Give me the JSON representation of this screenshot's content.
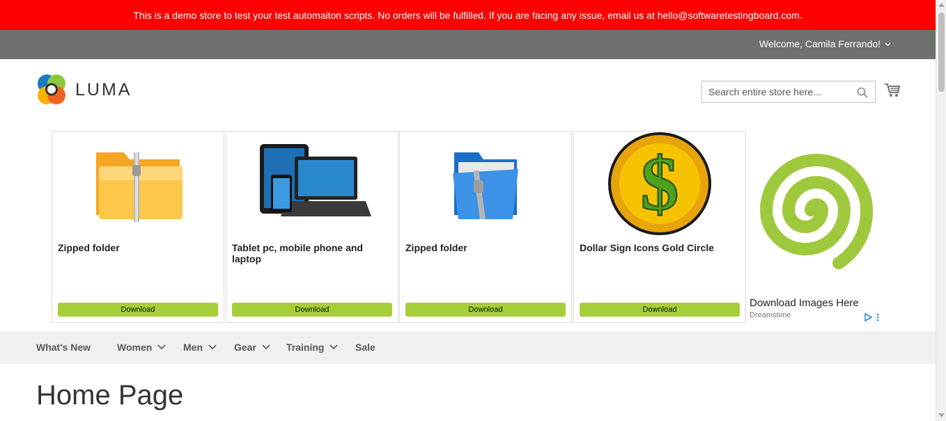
{
  "banner": {
    "text": "This is a demo store to test your test automaiton scripts. No orders will be fulfilled. If you are facing any issue, email us at hello@softwaretestingboard.com."
  },
  "header": {
    "welcome": "Welcome, Camila Ferrando!",
    "logo_text": "LUMA",
    "search_placeholder": "Search entire store here...",
    "icons": {
      "search": "search-icon",
      "cart": "cart-icon",
      "dropdown": "chevron-down-icon"
    }
  },
  "ads": {
    "cards": [
      {
        "title": "Zipped folder",
        "button": "Download",
        "image": "zipped-folder-orange"
      },
      {
        "title": "Tablet pc, mobile phone and laptop",
        "button": "Download",
        "image": "devices"
      },
      {
        "title": "Zipped folder",
        "button": "Download",
        "image": "zipped-folder-blue"
      },
      {
        "title": "Dollar Sign Icons Gold Circle",
        "button": "Download",
        "image": "dollar-coin"
      }
    ],
    "side": {
      "headline": "Download Images Here",
      "brand": "Dreamstime",
      "image": "green-spiral"
    },
    "colors": {
      "button": "#a6ce39"
    }
  },
  "nav": {
    "items": [
      {
        "label": "What's New",
        "has_dropdown": false
      },
      {
        "label": "Women",
        "has_dropdown": true
      },
      {
        "label": "Men",
        "has_dropdown": true
      },
      {
        "label": "Gear",
        "has_dropdown": true
      },
      {
        "label": "Training",
        "has_dropdown": true
      },
      {
        "label": "Sale",
        "has_dropdown": false
      }
    ]
  },
  "page": {
    "title": "Home Page"
  },
  "colors": {
    "banner": "#ff0000",
    "panel": "#6e716e",
    "nav_bg": "#f0f0f0"
  }
}
